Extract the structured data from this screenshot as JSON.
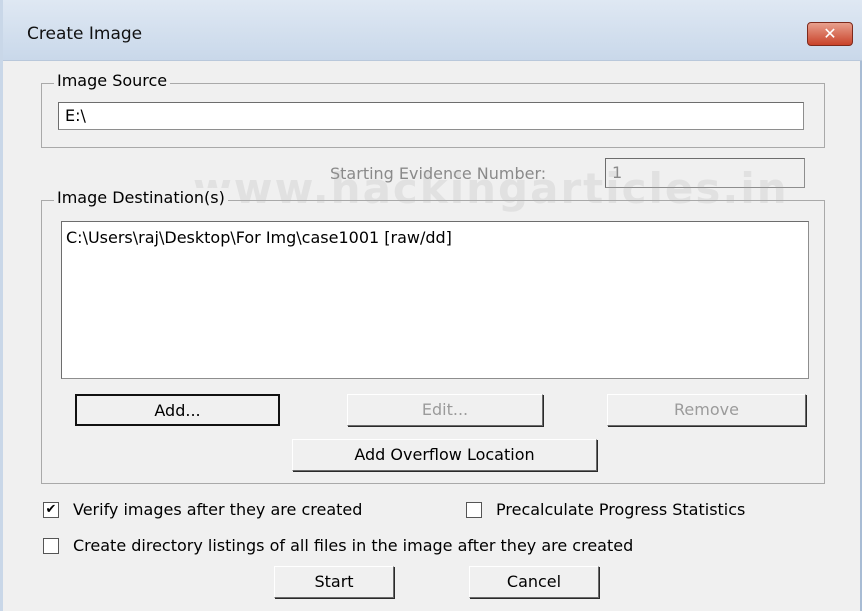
{
  "window": {
    "title": "Create Image",
    "close_glyph": "✕"
  },
  "image_source": {
    "legend": "Image Source",
    "value": "E:\\"
  },
  "evidence": {
    "label": "Starting Evidence Number:",
    "value": "1"
  },
  "watermark": "www.hackingarticles.in",
  "destinations": {
    "legend": "Image Destination(s)",
    "items": [
      "C:\\Users\\raj\\Desktop\\For Img\\case1001 [raw/dd]"
    ],
    "add_label": "Add...",
    "edit_label": "Edit...",
    "remove_label": "Remove",
    "overflow_label": "Add Overflow Location"
  },
  "options": {
    "verify": {
      "label": "Verify images after they are created",
      "checked": true
    },
    "precalc": {
      "label": "Precalculate Progress Statistics",
      "checked": false
    },
    "dir_listing": {
      "label": "Create directory listings of all files in the image after they are created",
      "checked": false
    }
  },
  "footer": {
    "start_label": "Start",
    "cancel_label": "Cancel"
  },
  "icons": {
    "check_glyph": "✔"
  }
}
